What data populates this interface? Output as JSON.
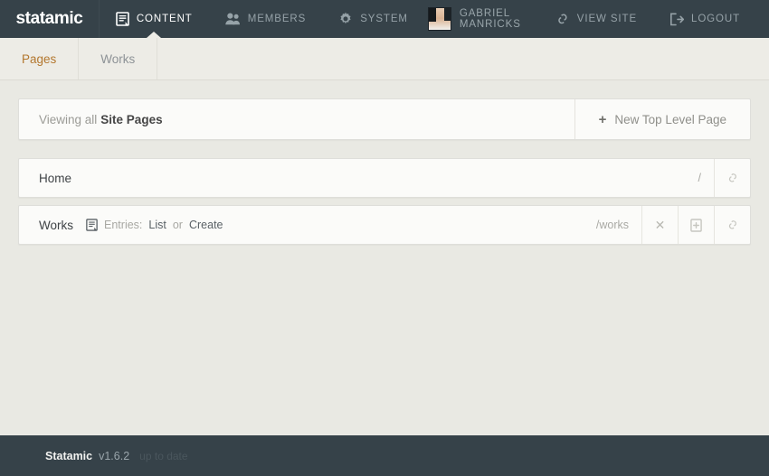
{
  "brand": {
    "logo": "statamic"
  },
  "colors": {
    "topbar_bg": "#364249",
    "accent": "#b3772e",
    "body_bg": "#e9e9e3",
    "panel_bg": "#fbfbf9"
  },
  "topnav": {
    "items": [
      {
        "label": "CONTENT",
        "icon": "document-icon",
        "active": true
      },
      {
        "label": "MEMBERS",
        "icon": "users-icon",
        "active": false
      },
      {
        "label": "SYSTEM",
        "icon": "gear-icon",
        "active": false
      }
    ],
    "user": {
      "name": "GABRIEL MANRICKS",
      "avatar": "user-avatar"
    },
    "view_site": {
      "label": "VIEW SITE",
      "icon": "link-icon"
    },
    "logout": {
      "label": "LOGOUT",
      "icon": "logout-icon"
    }
  },
  "subnav": {
    "tabs": [
      {
        "label": "Pages",
        "active": true
      },
      {
        "label": "Works",
        "active": false
      }
    ]
  },
  "main": {
    "viewing": {
      "prefix": "Viewing all",
      "target": "Site Pages"
    },
    "new_page_button": {
      "icon": "plus-icon",
      "label": "New Top Level Page"
    },
    "pages": [
      {
        "title": "Home",
        "url": "/",
        "entries": null,
        "actions": [
          "link-icon"
        ]
      },
      {
        "title": "Works",
        "url": "/works",
        "entries": {
          "icon": "document-icon",
          "label": "Entries:",
          "list_link": "List",
          "separator": "or",
          "create_link": "Create"
        },
        "actions": [
          "close-icon",
          "add-page-icon",
          "link-icon"
        ]
      }
    ]
  },
  "footer": {
    "name": "Statamic",
    "version": "v1.6.2",
    "status": "up to date"
  }
}
